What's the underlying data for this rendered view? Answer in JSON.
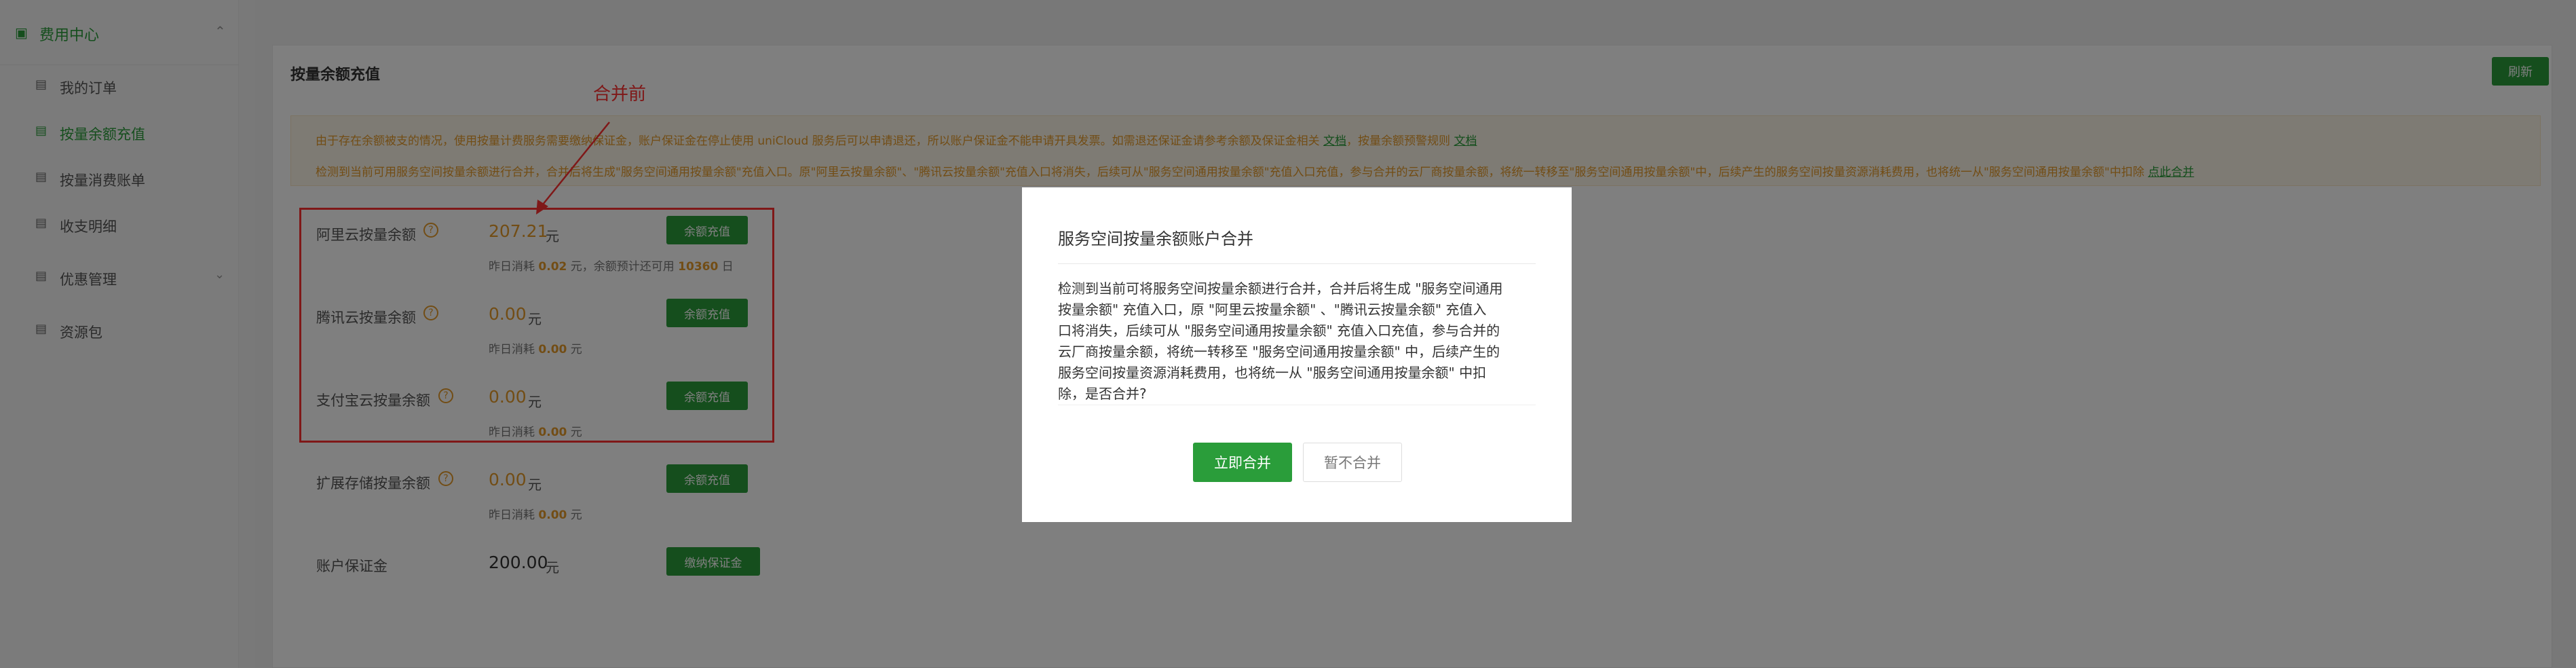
{
  "sidebar": {
    "group": {
      "label": "费用中心",
      "icon": "grid-icon"
    },
    "items": [
      {
        "label": "我的订单",
        "icon": "receipt-icon",
        "active": false
      },
      {
        "label": "按量余额充值",
        "icon": "receipt-icon",
        "active": true
      },
      {
        "label": "按量消费账单",
        "icon": "receipt-icon",
        "active": false
      },
      {
        "label": "收支明细",
        "icon": "receipt-icon",
        "active": false
      },
      {
        "label": "优惠管理",
        "icon": "receipt-icon",
        "active": false
      },
      {
        "label": "资源包",
        "icon": "receipt-icon",
        "active": false
      }
    ]
  },
  "page": {
    "title": "按量余额充值",
    "refresh_label": "刷新"
  },
  "notice": {
    "line1": "由于存在余额被支的情况，使用按量计费服务需要缴纳保证金，账户保证金在停止使用 uniCloud 服务后可以申请退还，所以账户保证金不能申请开具发票。如需退还保证金请参考余额及保证金相关",
    "line1_link1": "文档",
    "line1_mid": "，按量余额预警规则",
    "line1_link2": "文档",
    "line2": "检测到当前可用服务空间按量余额进行合并，合并后将生成\"服务空间通用按量余额\"充值入口。原\"阿里云按量余额\"、\"腾讯云按量余额\"充值入口将消失，后续可从\"服务空间通用按量余额\"充值入口充值，参与合并的云厂商按量余额，将统一转移至\"服务空间通用按量余额\"中，后续产生的服务空间按量资源消耗费用，也将统一从\"服务空间通用按量余额\"中扣除",
    "line2_link": "点此合并"
  },
  "annotation": "合并前",
  "balances": [
    {
      "name": "阿里云按量余额",
      "amount": "207.21",
      "unit": "元",
      "sub_prefix": "昨日消耗",
      "sub_value": "0.02",
      "sub_mid": "元，余额预计还可用",
      "sub_days": "10360",
      "sub_suffix": "日",
      "button": "余额充值"
    },
    {
      "name": "腾讯云按量余额",
      "amount": "0.00",
      "unit": "元",
      "sub_prefix": "昨日消耗",
      "sub_value": "0.00",
      "sub_suffix": "元",
      "button": "余额充值"
    },
    {
      "name": "支付宝云按量余额",
      "amount": "0.00",
      "unit": "元",
      "sub_prefix": "昨日消耗",
      "sub_value": "0.00",
      "sub_suffix": "元",
      "button": "余额充值"
    },
    {
      "name": "扩展存储按量余额",
      "amount": "0.00",
      "unit": "元",
      "sub_prefix": "昨日消耗",
      "sub_value": "0.00",
      "sub_suffix": "元",
      "button": "余额充值"
    }
  ],
  "deposit": {
    "name": "账户保证金",
    "amount": "200.00",
    "unit": "元",
    "button": "缴纳保证金"
  },
  "modal": {
    "title": "服务空间按量余额账户合并",
    "body": [
      "检测到当前可将服务空间按量余额进行合并，合并后将生成 \"服务空间通用",
      "按量余额\" 充值入口，原 \"阿里云按量余额\" 、\"腾讯云按量余额\" 充值入",
      "口将消失，后续可从 \"服务空间通用按量余额\" 充值入口充值，参与合并的",
      "云厂商按量余额，将统一转移至 \"服务空间通用按量余额\" 中，后续产生的",
      "服务空间按量资源消耗费用，也将统一从 \"服务空间通用按量余额\" 中扣",
      "除，是否合并?"
    ],
    "confirm_label": "立即合并",
    "cancel_label": "暂不合并"
  },
  "colors": {
    "accent": "#2a9d3a",
    "warning": "#e59a2a",
    "annotation": "#ff3030"
  }
}
